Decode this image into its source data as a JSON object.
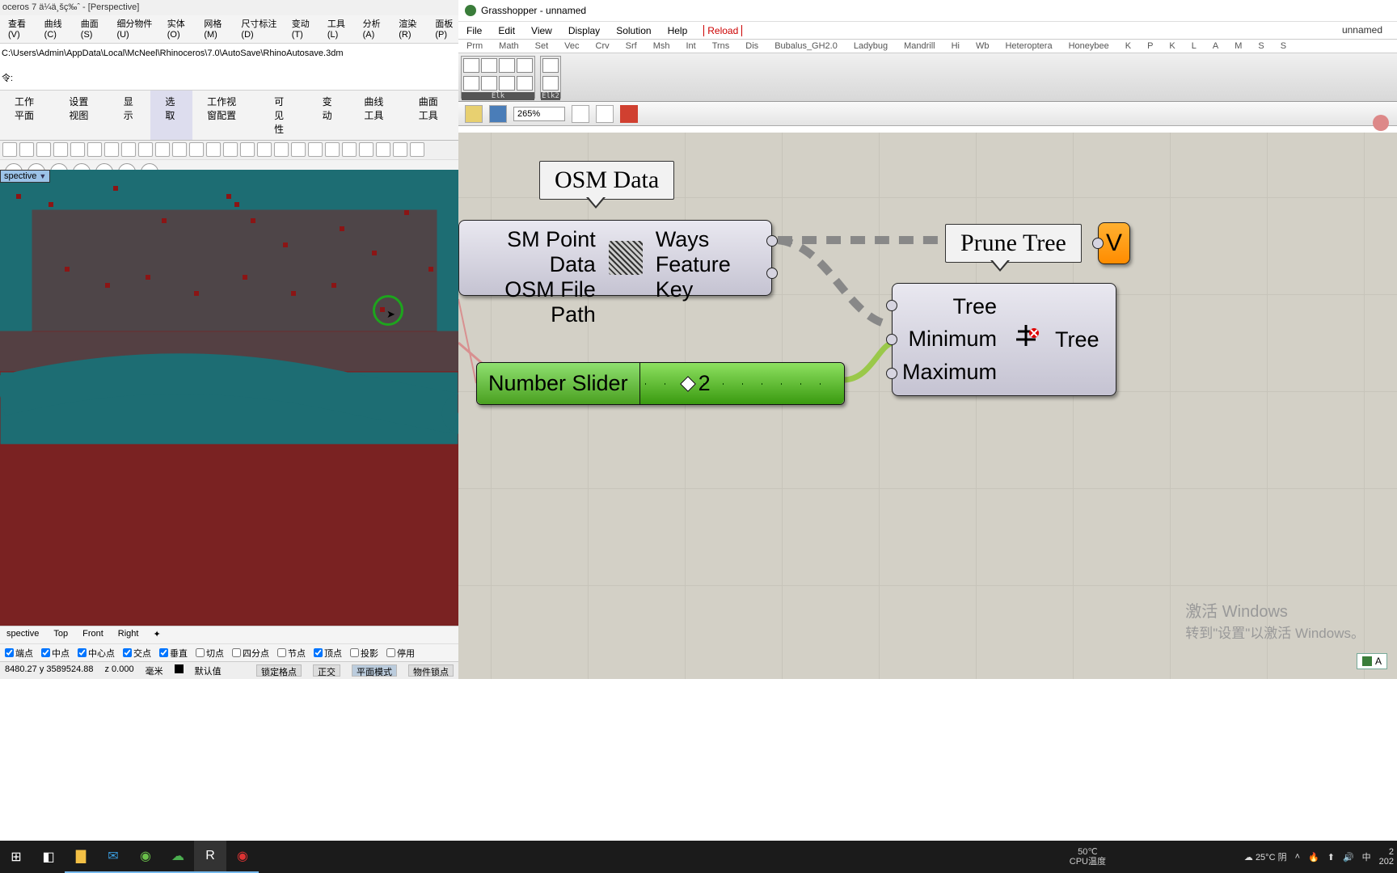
{
  "rhino": {
    "title": "oceros 7 ä¼ä¸šç‰ˆ - [Perspective]",
    "menu": [
      "查看(V)",
      "曲线(C)",
      "曲面(S)",
      "细分物件(U)",
      "实体(O)",
      "网格(M)",
      "尺寸标注(D)",
      "变动(T)",
      "工具(L)",
      "分析(A)",
      "渲染(R)",
      "面板(P)"
    ],
    "cmdline": "C:\\Users\\Admin\\AppData\\Local\\McNeel\\Rhinoceros\\7.0\\AutoSave\\RhinoAutosave.3dm",
    "prompt": "令:",
    "tooltabs": [
      "工作平面",
      "设置视图",
      "显示",
      "选取",
      "工作视窗配置",
      "可见性",
      "变动",
      "曲线工具",
      "曲面工具"
    ],
    "viewport_name": "spective",
    "vp_footer": [
      "spective",
      "Top",
      "Front",
      "Right",
      "✦"
    ],
    "osnap": [
      {
        "label": "端点",
        "checked": true
      },
      {
        "label": "中点",
        "checked": true
      },
      {
        "label": "中心点",
        "checked": true
      },
      {
        "label": "交点",
        "checked": true
      },
      {
        "label": "垂直",
        "checked": true
      },
      {
        "label": "切点",
        "checked": false
      },
      {
        "label": "四分点",
        "checked": false
      },
      {
        "label": "节点",
        "checked": false
      },
      {
        "label": "顶点",
        "checked": true
      },
      {
        "label": "投影",
        "checked": false
      },
      {
        "label": "停用",
        "checked": false
      }
    ],
    "status": {
      "coords": "8480.27 y 3589524.88",
      "z": "z 0.000",
      "unit": "毫米",
      "layer": "默认值",
      "buttons": [
        "锁定格点",
        "正交",
        "平面模式",
        "物件锁点"
      ],
      "active": "平面模式"
    }
  },
  "gh": {
    "title": "Grasshopper - unnamed",
    "docname": "unnamed",
    "menus": [
      "File",
      "Edit",
      "View",
      "Display",
      "Solution",
      "Help"
    ],
    "reload": "Reload",
    "cats": [
      "Prm",
      "Math",
      "Set",
      "Vec",
      "Crv",
      "Srf",
      "Msh",
      "Int",
      "Trns",
      "Dis",
      "Bubalus_GH2.0",
      "Ladybug",
      "Mandrill",
      "Hi",
      "Wb",
      "Heteroptera",
      "Honeybee",
      "K",
      "P",
      "K",
      "L",
      "A",
      "M",
      "S",
      "S"
    ],
    "panel_labels": [
      "Elk",
      "Elk2"
    ],
    "zoom": "265%",
    "scribbles": {
      "osm": "OSM Data",
      "prune": "Prune Tree"
    },
    "osm_comp": {
      "in1": "SM Point Data",
      "in2": "OSM File Path",
      "out1": "Ways",
      "out2": "Feature Key"
    },
    "ptree": {
      "in1": "Tree",
      "in2": "Minimum",
      "in3": "Maximum",
      "out": "Tree"
    },
    "slider": {
      "label": "Number Slider",
      "value": "2"
    },
    "orange_out": "V",
    "badge": "A",
    "watermark": {
      "l1": "激活 Windows",
      "l2": "转到\"设置\"以激活 Windows。"
    }
  },
  "taskbar": {
    "temp1": "50℃",
    "temp2": "CPU温度",
    "weather": "25°C 阴",
    "time1": "2",
    "time2": "202"
  }
}
